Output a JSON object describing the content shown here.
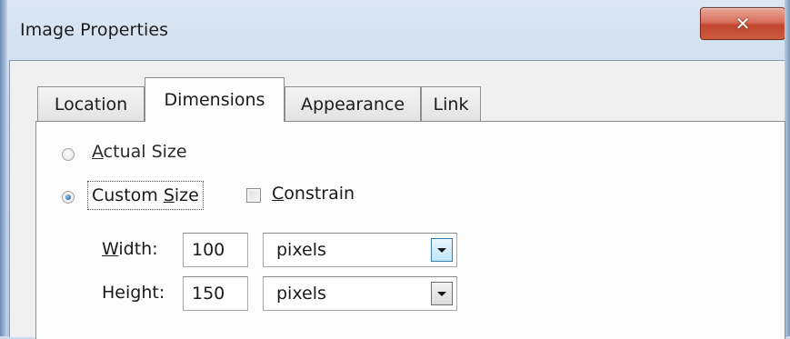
{
  "window": {
    "title": "Image Properties",
    "close_icon": "close-icon"
  },
  "tabs": [
    {
      "label": "Location",
      "active": false
    },
    {
      "label": "Dimensions",
      "active": true
    },
    {
      "label": "Appearance",
      "active": false
    },
    {
      "label": "Link",
      "active": false
    }
  ],
  "dimensions": {
    "actual_size": {
      "prefix": "",
      "accel": "A",
      "suffix": "ctual Size",
      "checked": false
    },
    "custom_size": {
      "prefix": "Custom ",
      "accel": "S",
      "suffix": "ize",
      "checked": true
    },
    "constrain": {
      "prefix": "",
      "accel": "C",
      "suffix": "onstrain",
      "checked": false
    },
    "width": {
      "label_prefix": "",
      "label_accel": "W",
      "label_suffix": "idth:",
      "value": "100",
      "unit": "pixels"
    },
    "height": {
      "label_prefix": "Hei",
      "label_accel": "g",
      "label_suffix": "ht:",
      "value": "150",
      "unit": "pixels"
    }
  }
}
